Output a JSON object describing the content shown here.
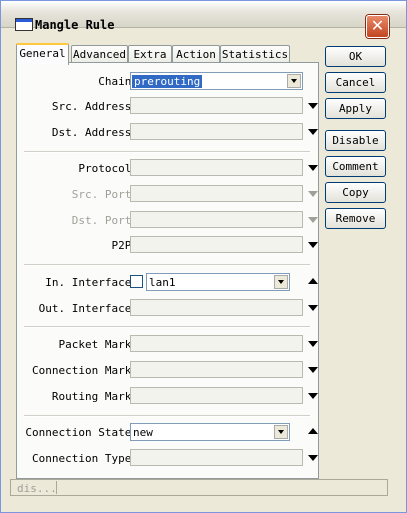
{
  "window": {
    "title": "Mangle Rule",
    "close_label": "✕"
  },
  "tabs": [
    "General",
    "Advanced",
    "Extra",
    "Action",
    "Statistics"
  ],
  "form": {
    "chain": {
      "label": "Chain:",
      "value": "prerouting"
    },
    "src_address": {
      "label": "Src. Address:"
    },
    "dst_address": {
      "label": "Dst. Address:"
    },
    "protocol": {
      "label": "Protocol:"
    },
    "src_port": {
      "label": "Src. Port:"
    },
    "dst_port": {
      "label": "Dst. Port:"
    },
    "p2p": {
      "label": "P2P:"
    },
    "in_interface": {
      "label": "In. Interface:",
      "value": "lan1"
    },
    "out_interface": {
      "label": "Out. Interface:"
    },
    "packet_mark": {
      "label": "Packet Mark:"
    },
    "connection_mark": {
      "label": "Connection Mark:"
    },
    "routing_mark": {
      "label": "Routing Mark:"
    },
    "connection_state": {
      "label": "Connection State:",
      "value": "new"
    },
    "connection_type": {
      "label": "Connection Type:"
    }
  },
  "buttons": [
    "OK",
    "Cancel",
    "Apply",
    "Disable",
    "Comment",
    "Copy",
    "Remove"
  ],
  "status": {
    "text": "dis..."
  }
}
